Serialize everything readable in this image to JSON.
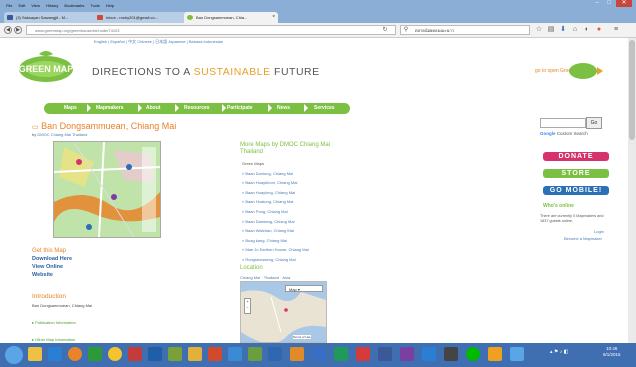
{
  "browser": {
    "menu": [
      "File",
      "Edit",
      "View",
      "History",
      "Bookmarks",
      "Tools",
      "Help"
    ],
    "tabs": [
      {
        "label": "(3) Saksayan Sawangjit - M...",
        "color": "#3b5998"
      },
      {
        "label": "Inbox - roshy201@gmail.co...",
        "color": "#d44638"
      },
      {
        "label": "Ban Dongsammuean, Chia...",
        "color": "#7cc043"
      }
    ],
    "new_tab": "+",
    "url": "www.greenmap.org/greenhouse/en/node/74103",
    "search_value": "ตลาดน้อยคลองมะนาว",
    "window_controls": [
      "–",
      "□",
      "✕"
    ]
  },
  "page": {
    "languages": "English | Español | 中文 Chinese | 日本語 Japanese | Bahasa Indonesian",
    "logo_text": "GREEN MAP",
    "tagline_a": "DIRECTIONS TO A ",
    "tagline_hl": "SUSTAINABLE",
    "tagline_b": " FUTURE",
    "gomapper": "go to open Green Map",
    "nav": [
      "Maps",
      "Mapmakers",
      "About",
      "Resources",
      "Participate",
      "News",
      "Services"
    ],
    "title": "Ban Dongsammuean, Chiang Mai",
    "byline_prefix": "by ",
    "byline_link": "DMOC Chiang Mai Thailand",
    "get_map": "Get this Map",
    "download": "Download Here",
    "view_online": "View Online",
    "website": "Website",
    "intro_hdr": "Introduction",
    "intro_text": "Ban Dongsammuean, Chiang Mai",
    "pub_info": "▸ Publication Information",
    "other_info": "▸ Other Map Information",
    "more_hdr": "More Maps by DMOC Chiang Mai Thailand",
    "more_list": [
      "Green Maps",
      "» Baan Donlung, Chiang Mai",
      "» Baan Huaykhom, Chiang Mai",
      "» Baan Huaylong, Chiang Mai",
      "» Baan Huatung, Chiang Mai",
      "» Baan Pong, Chiang Mai",
      "» Baan Dandang, Chiang Mai",
      "» Baan Watchan, Chiang Mai",
      "» Buag kang, Chiang Mai",
      "» Mae Jo Earthen House, Chiang Mai",
      "» Rongseowaeng, Chiang Mai"
    ],
    "location_hdr": "Location",
    "location_line": "Chiang Mai · Thailand · Asia",
    "map_type": "Map",
    "map_terms": "Terms of Use",
    "search_go": "Go",
    "gcse": "Custom Search",
    "donate": "DONATE",
    "store": "STORE",
    "mobile": "GO MOBILE!",
    "online_hdr": "Who's online",
    "online_text": "There are currently 0 Mapmakers and 1637 guests online.",
    "login": "Login",
    "become": "Become a Mapmaker"
  },
  "colors": {
    "green": "#7cc043",
    "orange": "#e8832a",
    "donate": "#d6336c",
    "store": "#7cc043",
    "mobile": "#2b6fb6"
  },
  "taskbar": {
    "clock_time": "10:46",
    "clock_date": "6/1/2016"
  }
}
